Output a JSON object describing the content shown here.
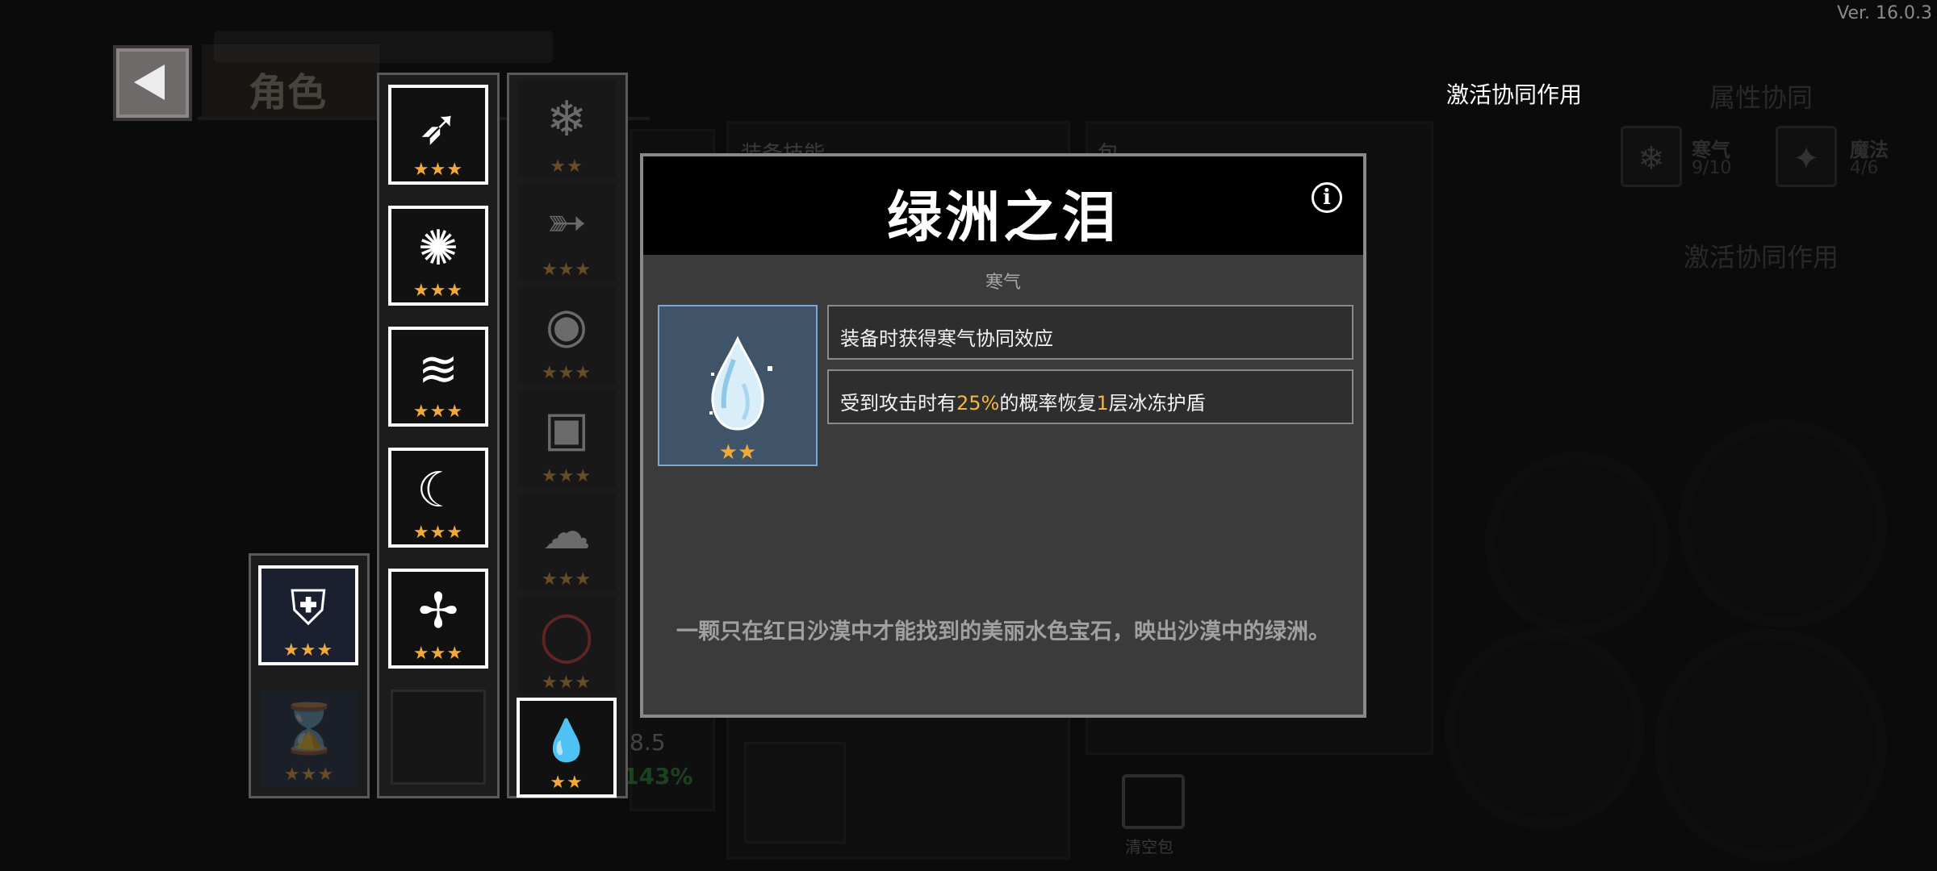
{
  "version": "Ver. 16.0.3",
  "header": {
    "role_tab": "角色",
    "back_label": "◀"
  },
  "right_panel": {
    "activate_link": "激活协同作用",
    "attr_title": "属性协同",
    "synergies": [
      {
        "name": "寒气",
        "count": "9/10",
        "icon": "snowflake-icon"
      },
      {
        "name": "魔法",
        "count": "4/6",
        "icon": "four-point-star-icon"
      }
    ],
    "activate_label": "激活协同作用"
  },
  "column_a": [
    {
      "icon": "shield-frost-icon",
      "glyph": "⛨",
      "stars": "★★★",
      "selected": true
    },
    {
      "icon": "hourglass-upgrade-icon",
      "glyph": "⌛",
      "stars": "★★★",
      "selected": false,
      "faded": true
    }
  ],
  "column_b": [
    {
      "icon": "ice-claw-icon",
      "glyph": "➶",
      "stars": "★★★"
    },
    {
      "icon": "winged-emblem-icon",
      "glyph": "✺",
      "stars": "★★★"
    },
    {
      "icon": "wind-slash-icon",
      "glyph": "≋",
      "stars": "★★★"
    },
    {
      "icon": "crescent-slash-icon",
      "glyph": "☾",
      "stars": "★★★"
    },
    {
      "icon": "frost-sword-icon",
      "glyph": "✢",
      "stars": "★★★"
    }
  ],
  "column_c": [
    {
      "icon": "snowflake-icon",
      "glyph": "❄",
      "stars": "★★"
    },
    {
      "icon": "arrow-icon",
      "glyph": "➳",
      "stars": "★★★"
    },
    {
      "icon": "orb-icon",
      "glyph": "◉",
      "stars": "★★★"
    },
    {
      "icon": "cube-icon",
      "glyph": "▣",
      "stars": "★★★"
    },
    {
      "icon": "cloud-icon",
      "glyph": "☁",
      "stars": "★★★"
    },
    {
      "icon": "red-ring-icon",
      "glyph": "◯",
      "stars": "★★★"
    },
    {
      "icon": "water-drop-icon",
      "glyph": "💧",
      "stars": "★★",
      "selected": true
    }
  ],
  "bg_fragments": {
    "trash_label": "清空包",
    "stat_a": "8.5",
    "stat_b": "143%",
    "tab_a": "装备技能",
    "tab_b": "包"
  },
  "modal": {
    "title": "绿洲之泪",
    "type": "寒气",
    "item_icon": "water-drop-icon",
    "item_stars": "★★",
    "effect1": "装备时获得寒气协同效应",
    "effect2_pre": "受到攻击时有",
    "effect2_pct": "25%",
    "effect2_mid": "的概率恢复",
    "effect2_num": "1",
    "effect2_post": "层冰冻护盾",
    "flavor": "一颗只在红日沙漠中才能找到的美丽水色宝石，映出沙漠中的绿洲。",
    "info_label": "i",
    "accent_color": "#f5b63b"
  }
}
